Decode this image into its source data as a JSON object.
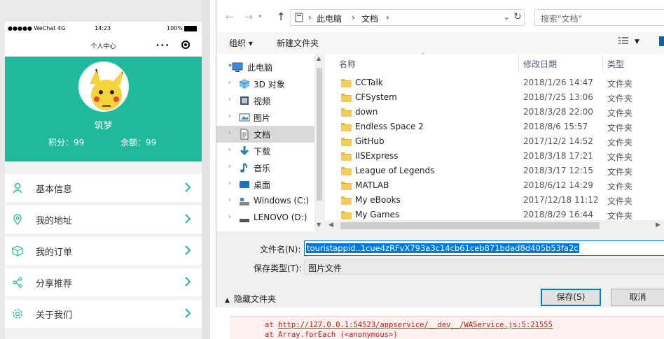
{
  "phone": {
    "status_carrier": "●●●●● WeChat 4G",
    "status_time": "14:23",
    "status_battery": "100%",
    "nav_title": "个人中心",
    "nav_more": "•••",
    "username": "筑梦",
    "points": "积分：99",
    "balance": "余额：99",
    "menu": [
      {
        "label": "基本信息",
        "icon": "user-icon"
      },
      {
        "label": "我的地址",
        "icon": "location-icon"
      },
      {
        "label": "我的订单",
        "icon": "box-icon"
      },
      {
        "label": "分享推荐",
        "icon": "share-icon"
      },
      {
        "label": "关于我们",
        "icon": "gear-icon"
      }
    ],
    "accent_color": "#20b99b"
  },
  "dialog": {
    "breadcrumb": [
      "此电脑",
      "文档"
    ],
    "search_placeholder": "搜索\"文档\"",
    "toolbar": {
      "organize": "组织 ▾",
      "new_folder": "新建文件夹"
    },
    "nav_items": [
      {
        "label": "此电脑",
        "icon": "computer-icon",
        "expand": "▾"
      },
      {
        "label": "3D 对象",
        "icon": "cube-icon",
        "expand": "›"
      },
      {
        "label": "视频",
        "icon": "video-icon",
        "expand": "›"
      },
      {
        "label": "图片",
        "icon": "picture-icon",
        "expand": "›"
      },
      {
        "label": "文档",
        "icon": "document-icon",
        "expand": "›"
      },
      {
        "label": "下载",
        "icon": "download-icon",
        "expand": "›"
      },
      {
        "label": "音乐",
        "icon": "music-icon",
        "expand": "›"
      },
      {
        "label": "桌面",
        "icon": "desktop-icon",
        "expand": "›"
      },
      {
        "label": "Windows (C:)",
        "icon": "drive-icon",
        "expand": "›"
      },
      {
        "label": "LENOVO (D:)",
        "icon": "drive-icon",
        "expand": "›"
      }
    ],
    "columns": {
      "name": "名称",
      "date": "修改日期",
      "type": "类型"
    },
    "files": [
      {
        "name": "CCTalk",
        "date": "2018/1/26 14:47",
        "type": "文件夹"
      },
      {
        "name": "CFSystem",
        "date": "2018/7/25 13:06",
        "type": "文件夹"
      },
      {
        "name": "down",
        "date": "2018/3/28 22:00",
        "type": "文件夹"
      },
      {
        "name": "Endless Space 2",
        "date": "2018/8/6 15:57",
        "type": "文件夹"
      },
      {
        "name": "GitHub",
        "date": "2017/12/2 14:52",
        "type": "文件夹"
      },
      {
        "name": "IISExpress",
        "date": "2018/3/18 17:21",
        "type": "文件夹"
      },
      {
        "name": "League of Legends",
        "date": "2018/3/17 12:15",
        "type": "文件夹"
      },
      {
        "name": "MATLAB",
        "date": "2018/6/12 14:29",
        "type": "文件夹"
      },
      {
        "name": "My eBooks",
        "date": "2017/12/18 11:12",
        "type": "文件夹"
      },
      {
        "name": "My Games",
        "date": "2018/8/29 16:44",
        "type": "文件夹"
      }
    ],
    "filename_label": "文件名(N):",
    "filename_value": "touristappid..1cue4zRFvX793a3c14cb61ceb871bdad8d405b53fa2c",
    "filetype_label": "保存类型(T):",
    "filetype_value": "图片文件",
    "hide_folders": "隐藏文件夹",
    "save_button": "保存(S)",
    "cancel_button": "取消"
  },
  "console": {
    "line1_prefix": "at ",
    "line1_link": "http://127.0.0.1:54523/appservice/__dev__/WAService.js:5:21555",
    "line2": "at Array.forEach (<anonymous>)"
  }
}
